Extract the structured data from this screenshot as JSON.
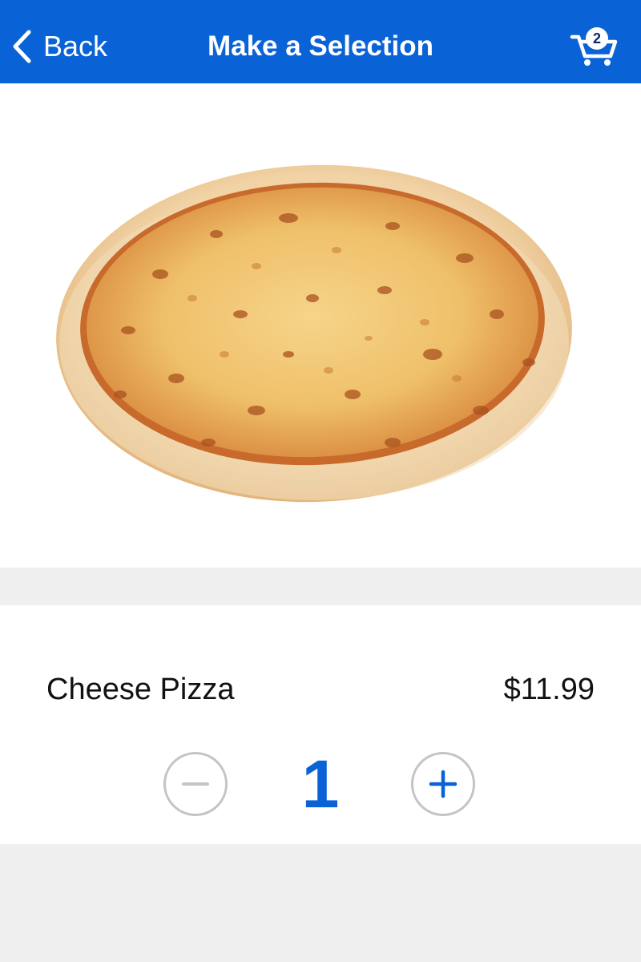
{
  "header": {
    "back_label": "Back",
    "title": "Make a Selection",
    "cart_count": "2"
  },
  "product": {
    "name": "Cheese Pizza",
    "price": "$11.99",
    "image_alt": "Cheese pizza"
  },
  "stepper": {
    "quantity": "1"
  },
  "icons": {
    "back": "chevron-left-icon",
    "cart": "shopping-cart-icon",
    "minus": "minus-icon",
    "plus": "plus-icon"
  },
  "colors": {
    "accent": "#0a63d6",
    "background": "#efefef",
    "card": "#ffffff",
    "stepper_border": "#c4c4c4"
  }
}
